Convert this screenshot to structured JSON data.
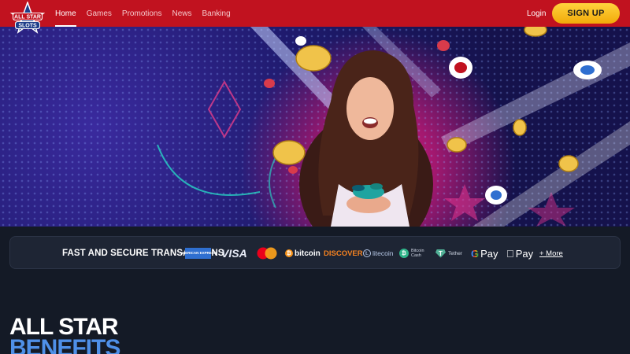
{
  "header": {
    "logo": {
      "name": "all-star-slots-logo",
      "text": "ALL STAR SLOTS"
    },
    "nav": [
      {
        "label": "Home",
        "active": true
      },
      {
        "label": "Games",
        "active": false
      },
      {
        "label": "Promotions",
        "active": false
      },
      {
        "label": "News",
        "active": false
      },
      {
        "label": "Banking",
        "active": false
      }
    ],
    "login_label": "Login",
    "signup_label": "SIGN UP",
    "colors": {
      "bar": "#c1121f",
      "signup": "#f5b90f"
    }
  },
  "hero": {
    "description_icons": [
      "gold-coin-icon",
      "casino-chip-icon",
      "neon-diamond-icon",
      "neon-star-icon"
    ]
  },
  "payments": {
    "title": "FAST AND SECURE TRANSACTIONS",
    "methods": [
      {
        "name": "amex",
        "label": "AMERICAN EXPRESS"
      },
      {
        "name": "visa",
        "label": "VISA"
      },
      {
        "name": "mastercard",
        "label": ""
      },
      {
        "name": "bitcoin",
        "label": "bitcoin"
      },
      {
        "name": "discover",
        "label": "DISCOVER"
      },
      {
        "name": "litecoin",
        "label": "litecoin"
      },
      {
        "name": "bitcoin-cash",
        "label": "Bitcoin Cash"
      },
      {
        "name": "tether",
        "label": "Tether"
      },
      {
        "name": "google-pay",
        "label": "Pay"
      },
      {
        "name": "apple-pay",
        "label": "Pay"
      }
    ],
    "more_label": "+ More"
  },
  "benefits": {
    "line1": "ALL STAR",
    "line2": "BENEFITS"
  }
}
